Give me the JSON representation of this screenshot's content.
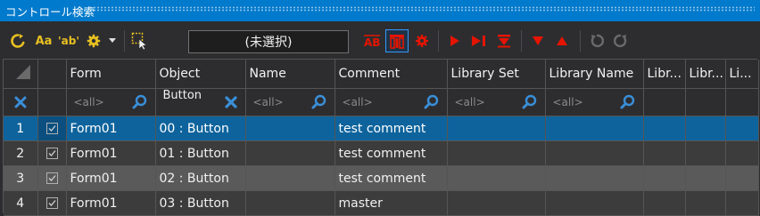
{
  "window": {
    "title": "コントロール検索"
  },
  "toolbar": {
    "selection_label": "(未選択)",
    "match_case_label": "Aa",
    "whole_word_label": "'ab'",
    "icons": {
      "refresh": "refresh-icon",
      "match_case": "match-case-icon",
      "whole_word": "whole-word-icon",
      "settings": "gear-icon",
      "dropdown": "chevron-down-icon",
      "pick": "select-pointer-icon",
      "ab_replace": "ab-replace-icon",
      "columns": "columns-icon",
      "record": "record-icon",
      "play": "play-icon",
      "play_next": "play-next-icon",
      "move_down": "move-down-icon",
      "arrow_down": "arrow-down-icon",
      "arrow_up": "arrow-up-icon",
      "undo": "undo-icon",
      "redo": "redo-icon"
    },
    "colors": {
      "accent_yellow": "#e8c020",
      "accent_red": "#e51400",
      "disabled": "#6a6a6a"
    }
  },
  "grid": {
    "columns": [
      "",
      "",
      "Form",
      "Object",
      "Name",
      "Comment",
      "Library Set",
      "Library Name",
      "Libr...",
      "Libr...",
      "Li..."
    ],
    "filters": {
      "placeholder": "<all>",
      "object_value": "Button"
    },
    "rows": [
      {
        "num": "1",
        "checked": true,
        "form": "Form01",
        "object": "00 : Button",
        "name": "",
        "comment": "test comment"
      },
      {
        "num": "2",
        "checked": true,
        "form": "Form01",
        "object": "01 : Button",
        "name": "",
        "comment": "test comment"
      },
      {
        "num": "3",
        "checked": true,
        "form": "Form01",
        "object": "02 : Button",
        "name": "",
        "comment": "test comment"
      },
      {
        "num": "4",
        "checked": true,
        "form": "Form01",
        "object": "03 : Button",
        "name": "",
        "comment": "master"
      }
    ],
    "colors": {
      "selected_row": "#0e639c",
      "header_bg": "#2d2d30",
      "clear_icon": "#3a8fd8"
    }
  }
}
